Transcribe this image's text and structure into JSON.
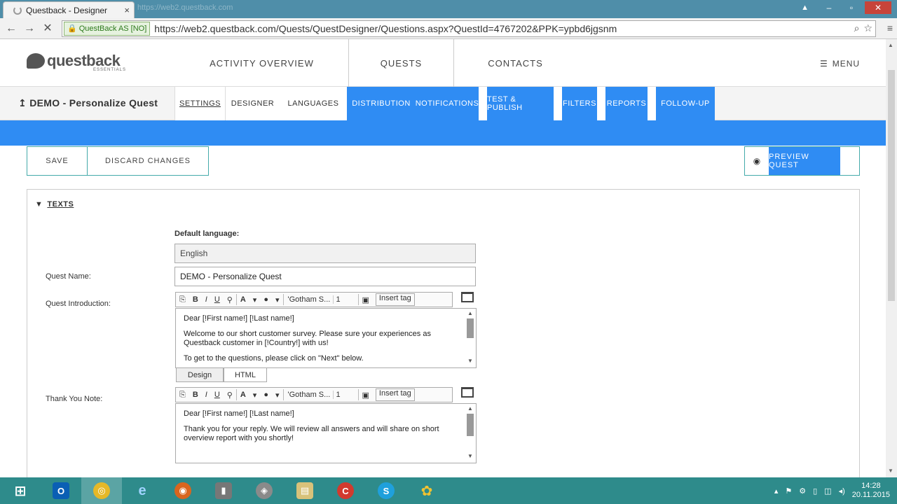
{
  "browser": {
    "tab_title": "Questback - Designer",
    "tab_close": "×",
    "ghost_tab": "https://web2.questback.com",
    "ev_label": "QuestBack AS [NO]",
    "url": "https://web2.questback.com/Quests/QuestDesigner/Questions.aspx?QuestId=4767202&PPK=ypbd6jgsnm",
    "back": "←",
    "forward": "→",
    "stop": "✕",
    "zoom_icon": "⌕",
    "star_icon": "☆",
    "menu_icon": "≡",
    "minimize": "–",
    "maximize": "▫",
    "close": "✕",
    "user_icon": "▲"
  },
  "header": {
    "logo_text": "questback",
    "logo_sub": "ESSENTIALS",
    "nav": [
      "ACTIVITY OVERVIEW",
      "QUESTS",
      "CONTACTS"
    ],
    "menu_label": "MENU",
    "menu_icon": "☰"
  },
  "subnav": {
    "quest_title": "DEMO - Personalize Quest",
    "quest_icon": "↥",
    "tabs": [
      "SETTINGS",
      "DESIGNER",
      "LANGUAGES",
      "DISTRIBUTION",
      "NOTIFICATIONS",
      "TEST & PUBLISH",
      "FILTERS",
      "REPORTS",
      "FOLLOW-UP"
    ]
  },
  "actions": {
    "save": "SAVE",
    "discard": "DISCARD CHANGES",
    "preview": "PREVIEW QUEST",
    "eye_icon": "◉"
  },
  "panel": {
    "section_title": "TEXTS",
    "toggle_icon": "▼",
    "default_language_label": "Default language:",
    "default_language_value": "English",
    "quest_name_label": "Quest Name:",
    "quest_name_value": "DEMO - Personalize Quest",
    "intro_label": "Quest Introduction:",
    "thanks_label": "Thank You Note:",
    "toolbar": {
      "paste": "⎘",
      "bold": "B",
      "italic": "I",
      "underline": "U",
      "link": "⚲",
      "font_color": "A",
      "bg_color": "●",
      "caret": "▾",
      "font": "'Gotham S...",
      "size": "1",
      "image": "▣",
      "insert_tag": "Insert tag"
    },
    "intro_lines": [
      "Dear [!First name!] [!Last name!]",
      "Welcome to our short customer survey. Please sure your experiences as Questback customer in [!Country!] with us!",
      "To get to the questions, please click on \"Next\" below."
    ],
    "thanks_lines": [
      "Dear [!First name!] [!Last name!]",
      "Thank you for your reply. We will review all answers and will share on short overview report with you shortly!"
    ],
    "mode_design": "Design",
    "mode_html": "HTML",
    "scroll_up": "▲",
    "scroll_down": "▼"
  },
  "taskbar": {
    "start_icon": "⊞",
    "apps": [
      "O",
      "◎",
      "e",
      "◉",
      "▮",
      "◈",
      "▤",
      "C",
      "S",
      "✿"
    ],
    "time": "14:28",
    "date": "20.11.2015",
    "tray_icons": [
      "▴",
      "⚑",
      "⚙",
      "▯",
      "◫",
      "◂)"
    ]
  },
  "colors": {
    "accent_blue": "#2f8cf3",
    "titlebar": "#4f8ea9",
    "taskbar": "#2e8b8b",
    "border_teal": "#44aaaa"
  }
}
